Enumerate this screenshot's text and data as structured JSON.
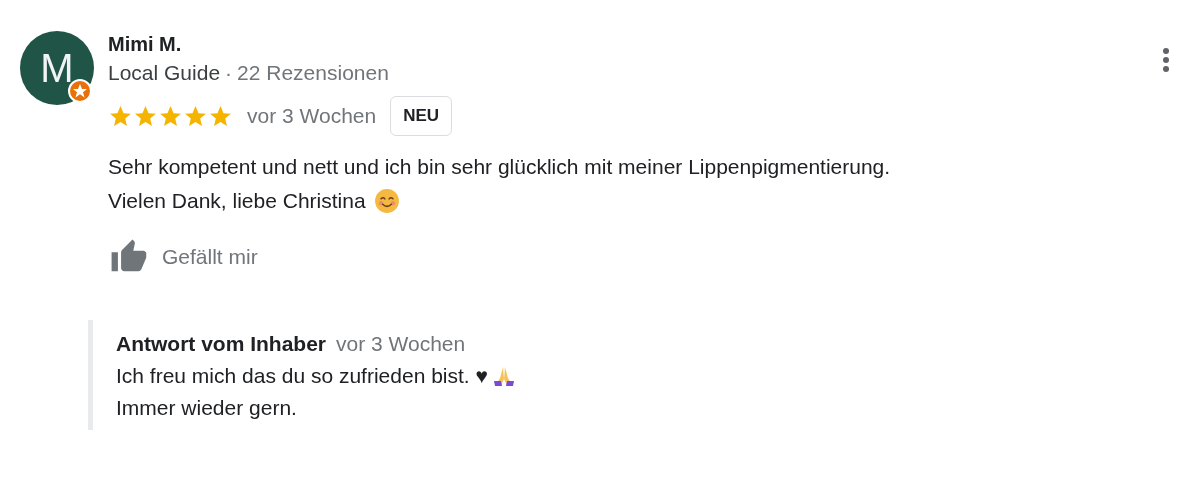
{
  "review": {
    "avatar_letter": "M",
    "local_guide": true,
    "author": "Mimi M.",
    "guide_label": "Local Guide",
    "separator": "·",
    "review_count": "22 Rezensionen",
    "stars": 5,
    "date": "vor 3 Wochen",
    "badge": "NEU",
    "text_lines": [
      "Sehr kompetent und nett und ich bin sehr glücklich mit meiner Lippenpigmentierung.",
      "Vielen Dank, liebe Christina"
    ],
    "like_label": "Gefällt mir"
  },
  "owner_reply": {
    "title": "Antwort vom Inhaber",
    "date": "vor 3 Wochen",
    "text_lines": [
      "Ich freu mich das du so zufrieden bist. ♥",
      "Immer wieder gern."
    ]
  }
}
